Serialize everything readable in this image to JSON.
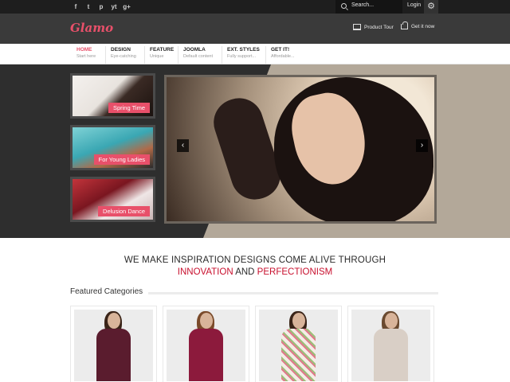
{
  "topbar": {
    "social": [
      "f",
      "t",
      "p",
      "yt",
      "g+"
    ],
    "search_label": "Search...",
    "login_label": "Login"
  },
  "header": {
    "logo": "Glamo",
    "product_tour": "Product Tour",
    "get_it_now": "Get it now"
  },
  "nav": {
    "items": [
      {
        "title": "HOME",
        "desc": "Start here"
      },
      {
        "title": "DESIGN",
        "desc": "Eye-catching"
      },
      {
        "title": "FEATURE",
        "desc": "Unique"
      },
      {
        "title": "JOOMLA",
        "desc": "Default content"
      },
      {
        "title": "EXT. STYLES",
        "desc": "Fully support..."
      },
      {
        "title": "GET IT!",
        "desc": "Affordable..."
      }
    ]
  },
  "hero": {
    "thumbs": [
      {
        "caption": "Spring Time"
      },
      {
        "caption": "For Young Ladies"
      },
      {
        "caption": "Delusion Dance"
      }
    ],
    "prev_arrow": "‹",
    "next_arrow": "›"
  },
  "tagline": {
    "line1": "WE MAKE INSPIRATION DESIGNS COME ALIVE THROUGH",
    "hl1": "INNOVATION",
    "and": "AND",
    "hl2": "PERFECTIONISM"
  },
  "featured": {
    "title": "Featured Categories"
  },
  "colors": {
    "accent": "#e8506a",
    "highlight": "#c8102e",
    "dark": "#3a3a3a"
  }
}
